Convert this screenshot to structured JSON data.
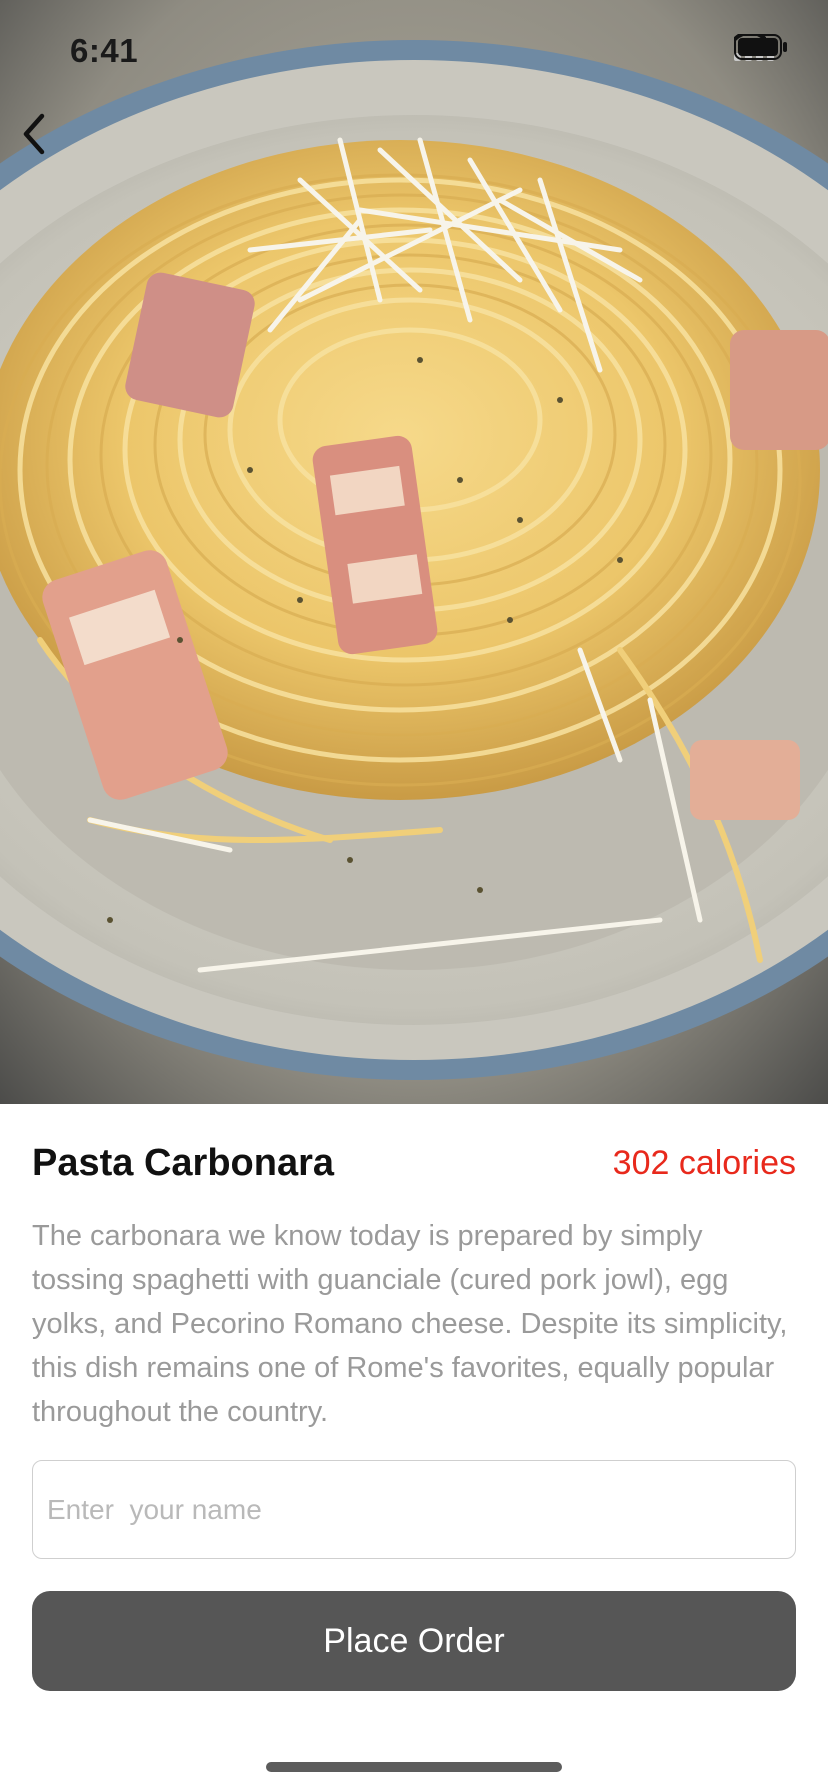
{
  "status_bar": {
    "time": "6:41",
    "icons": [
      "signal-icon",
      "wifi-icon",
      "battery-icon"
    ]
  },
  "navigation": {
    "back_icon": "chevron-left-icon"
  },
  "hero_image": {
    "subject": "plate-of-pasta-carbonara"
  },
  "dish": {
    "title": "Pasta Carbonara",
    "calories": "302 calories",
    "description": "The carbonara we know today is prepared by simply tossing spaghetti with guanciale (cured pork jowl), egg yolks, and Pecorino Romano cheese. Despite its simplicity, this dish remains one of Rome's favorites, equally popular throughout the country."
  },
  "form": {
    "name_placeholder": "Enter  your name",
    "name_value": "",
    "order_button_label": "Place Order"
  },
  "colors": {
    "calories": "#e8291c",
    "button_bg": "#565656",
    "description_text": "#9a9a9a"
  }
}
